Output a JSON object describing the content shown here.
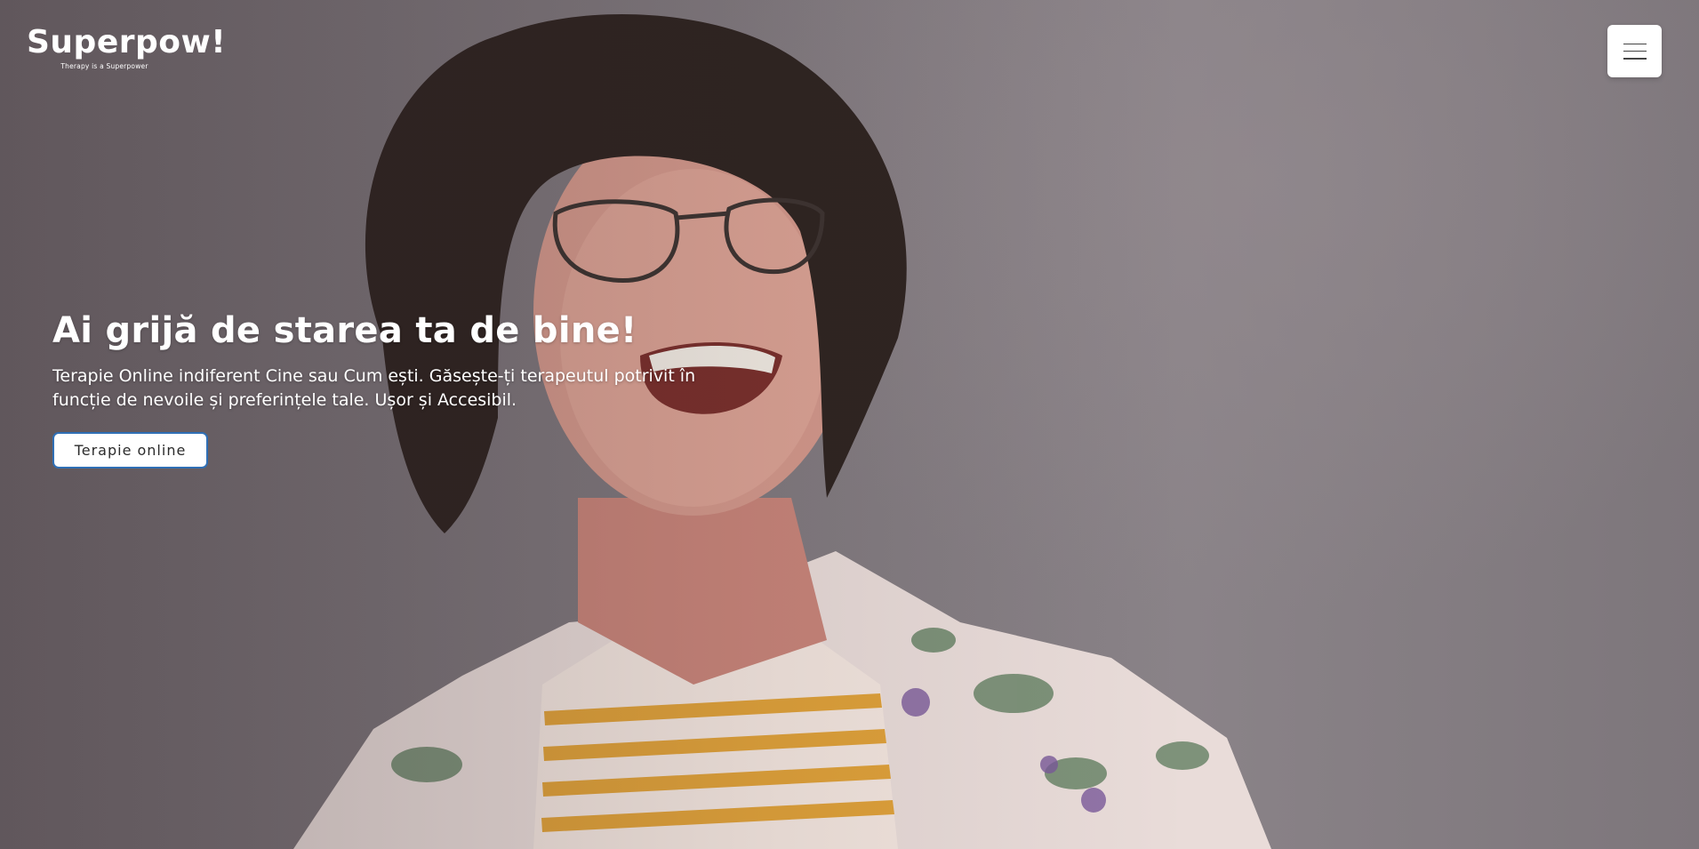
{
  "header": {
    "logo_name": "Superpow!",
    "logo_tagline": "Therapy is a Superpower",
    "menu_icon": "hamburger-icon"
  },
  "hero": {
    "title": "Ai grijă de starea ta de bine!",
    "subtitle": "Terapie Online indiferent Cine sau Cum ești. Găsește-ți terapeutul potrivit în funcție de nevoile și preferințele tale. Ușor și Accesibil.",
    "cta_label": "Terapie online",
    "image_alt": "laughing young man with curly hair and glasses"
  },
  "colors": {
    "background": "#7a7276",
    "cta_border": "#2f6fb5",
    "text": "#ffffff"
  }
}
